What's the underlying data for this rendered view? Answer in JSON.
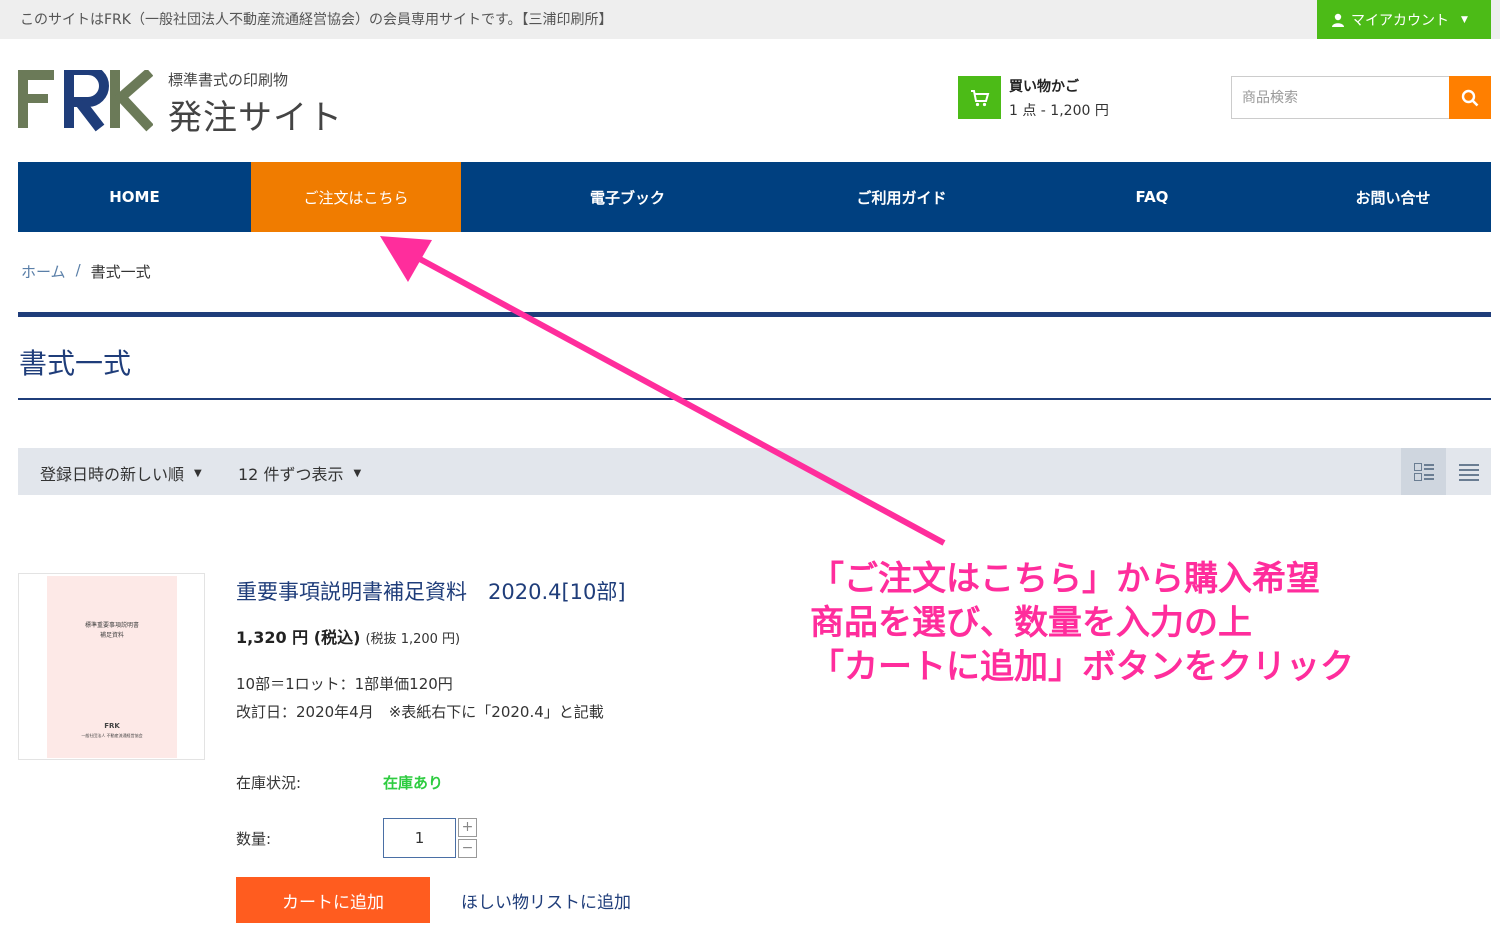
{
  "topbar": {
    "notice": "このサイトはFRK（一般社団法人不動産流通経営協会）の会員専用サイトです。【三浦印刷所】",
    "account_label": "マイアカウント"
  },
  "header": {
    "logo_letters": "FRK",
    "logo_sub": "標準書式の印刷物",
    "logo_main": "発注サイト",
    "cart_title": "買い物かご",
    "cart_summary": "1 点 - 1,200 円",
    "search_placeholder": "商品検索"
  },
  "nav": {
    "items": [
      {
        "label": "HOME"
      },
      {
        "label": "ご注文はこちら"
      },
      {
        "label": "電子ブック"
      },
      {
        "label": "ご利用ガイド"
      },
      {
        "label": "FAQ"
      },
      {
        "label": "お問い合せ"
      }
    ]
  },
  "breadcrumb": {
    "home": "ホーム",
    "separator": "/",
    "current": "書式一式"
  },
  "page": {
    "title": "書式一式"
  },
  "toolbar": {
    "sort_label": "登録日時の新しい順",
    "perpage_label": "12 件ずつ表示"
  },
  "product": {
    "thumb_line1": "標準重要事項説明書",
    "thumb_line2": "補足資料",
    "thumb_brand": "FRK",
    "thumb_org": "一般社団法人 不動産流通経営協会",
    "name": "重要事項説明書補足資料　2020.4[10部]",
    "price_incl": "1,320 円 (税込)",
    "price_excl": "(税抜 1,200 円)",
    "desc_line1": "10部＝1ロット：1部単価120円",
    "desc_line2": "改訂日：2020年4月　※表紙右下に「2020.4」と記載",
    "stock_label": "在庫状況:",
    "stock_value": "在庫あり",
    "qty_label": "数量:",
    "qty_value": "1",
    "qty_plus": "+",
    "qty_minus": "−",
    "add_to_cart": "カートに追加",
    "wishlist": "ほしい物リストに追加"
  },
  "annotation": {
    "line1": "「ご注文はこちら」から購入希望",
    "line2": "商品を選び、数量を入力の上",
    "line3": "「カートに追加」ボタンをクリック",
    "color": "#ff2d9c"
  },
  "colors": {
    "nav_bg": "#004080",
    "nav_active": "#f07c00",
    "account_green": "#4cbb17",
    "search_orange": "#ff7f00",
    "add_cart_orange": "#ff5c1f",
    "title_blue": "#1f3d7a",
    "stock_green": "#2ecc40"
  }
}
